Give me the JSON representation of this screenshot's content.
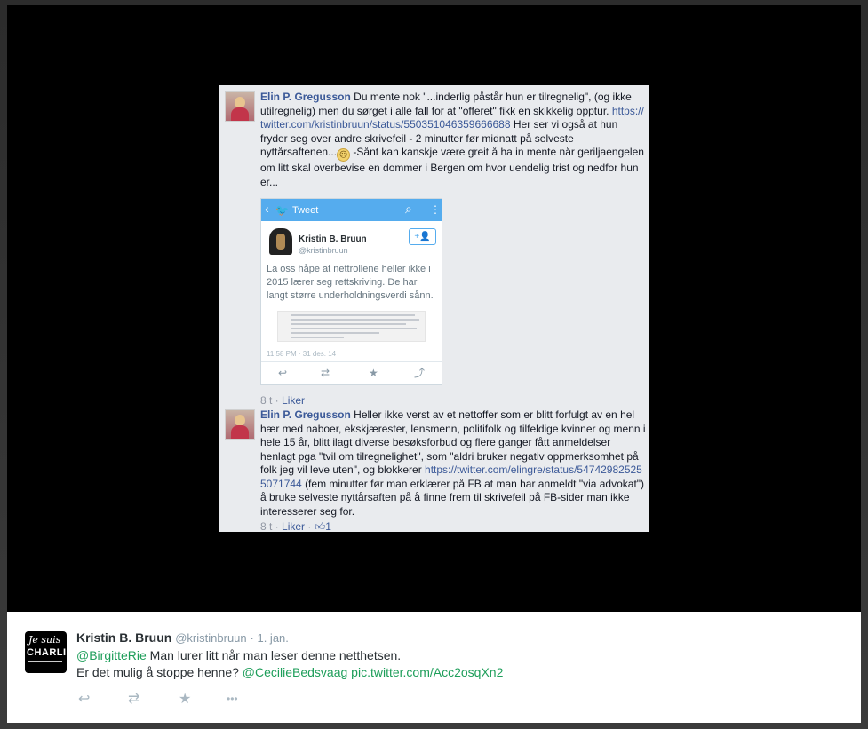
{
  "facebook": {
    "comments": [
      {
        "name": "Elin P. Gregusson",
        "text1": "Du mente nok \"...inderlig påstår hun er tilregnelig\", (og ikke utilregnelig) men du sørget i alle fall for at \"offeret\" fikk en skikkelig opptur.",
        "link": "https://twitter.com/kristinbruun/status/550351046359666688",
        "text2": "Her ser vi også at hun fryder seg over andre skrivefeil - 2 minutter før midnatt på selveste nyttårsaftenen...",
        "text3": "-Sånt kan kanskje være greit å ha in mente når geriljaengelen om litt skal overbevise en dommer i Bergen om hvor uendelig trist og nedfor hun er...",
        "time": "8 t",
        "like": "Liker"
      },
      {
        "name": "Elin P. Gregusson",
        "text1": "Heller ikke verst av et nettoffer som er blitt forfulgt av en hel hær med naboer, ekskjærester, lensmenn, politifolk og tilfeldige kvinner og menn i hele 15 år, blitt ilagt diverse besøksforbud og flere ganger fått anmeldelser henlagt pga \"tvil om tilregnelighet\", som \"aldri bruker negativ oppmerksomhet på folk jeg vil leve uten\", og blokkerer",
        "link": "https://twitter.com/elingre/status/547429825255071744",
        "text2": "(fem minutter før man erklærer på FB at man har anmeldt \"via advokat\") å bruke selveste nyttårsaften på å finne frem til skrivefeil på FB-sider man ikke interesserer seg for.",
        "time": "8 t",
        "like": "Liker",
        "likes_count": "1"
      }
    ],
    "embedded_tweet": {
      "header": "Tweet",
      "name": "Kristin B. Bruun",
      "handle": "@kristinbruun",
      "text": "La oss håpe at nettrollene heller ikke i 2015 lærer seg rettskriving. De har langt større underholdningsverdi sånn.",
      "time": "11:58 PM · 31 des. 14"
    }
  },
  "tweet": {
    "name": "Kristin B. Bruun",
    "handle": "@kristinbruun",
    "date": "· 1. jan.",
    "mention1": "@BirgitteRie",
    "line1": " Man lurer litt når man leser denne netthetsen.",
    "line2": "Er det mulig å stoppe henne? ",
    "mention2": "@CecilieBedsvaag",
    "pic_link": " pic.twitter.com/Acc2osqXn2",
    "avatar_text1": "Je suis",
    "avatar_text2": "CHARLIE"
  },
  "icons": {
    "reply": "↩",
    "retweet": "⇄",
    "favorite": "★",
    "more": "•••",
    "thumbs_up": "👍",
    "back": "‹",
    "search": "⌕",
    "menu": "⋮",
    "share": "⤴",
    "follow": "+👤",
    "emoji": "🙁"
  }
}
